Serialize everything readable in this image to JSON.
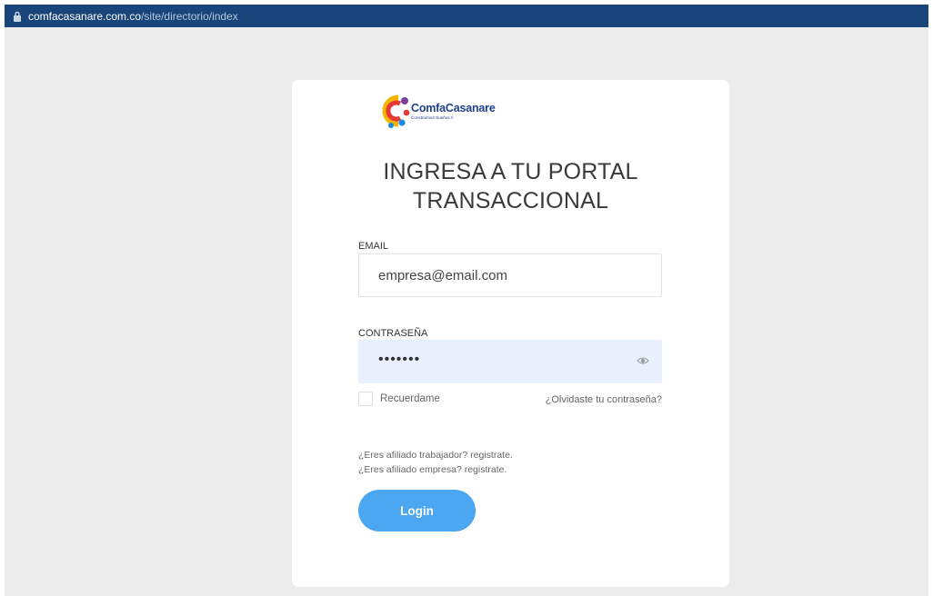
{
  "browser": {
    "url_domain": "comfacasanare.com.co",
    "url_path": "/site/directorio/index",
    "lock_icon": "lock-icon"
  },
  "logo": {
    "name": "ComfaCasanare",
    "tagline": "Construimos Sueños !!"
  },
  "login": {
    "title_line1": "INGRESA A TU PORTAL",
    "title_line2": "TRANSACCIONAL",
    "email_label": "EMAIL",
    "email_value": "empresa@email.com",
    "password_label": "CONTRASEÑA",
    "password_value": "•••••••",
    "eye_icon": "eye-icon",
    "remember_label": "Recuerdame",
    "forgot_link": "¿Olvidaste tu contraseña?",
    "register_worker": "¿Eres afiliado trabajador? registrate.",
    "register_company": "¿Eres afiliado empresa? registrate.",
    "login_button": "Login"
  },
  "colors": {
    "url_bar": "#19457a",
    "page_bg": "#ececec",
    "button": "#4ba7f2",
    "autofill_bg": "#e8f0fe",
    "brand_blue": "#1e3f8c"
  }
}
